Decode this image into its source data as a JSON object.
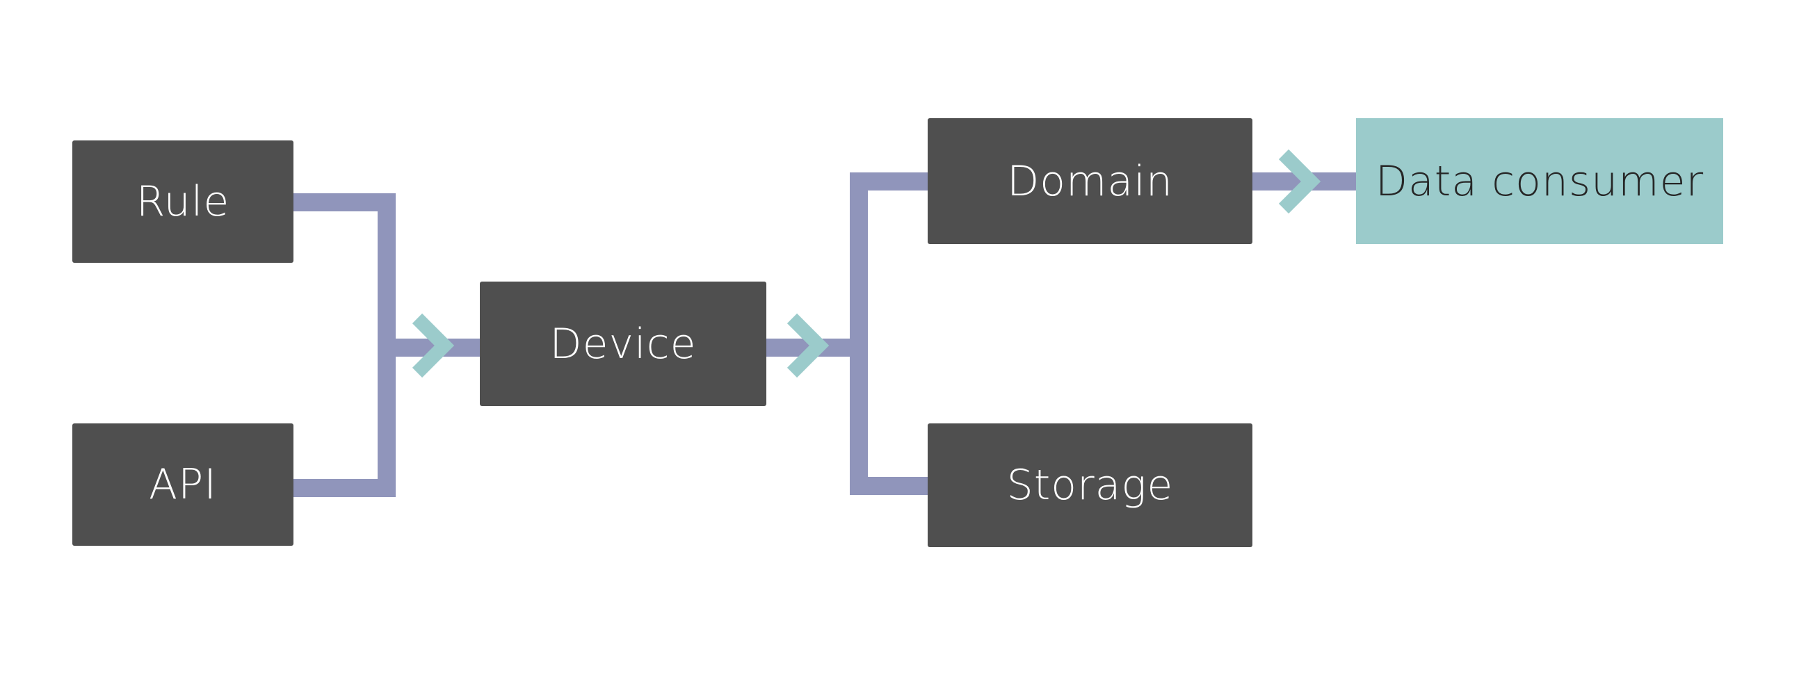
{
  "colors": {
    "box": "#4f4f4f",
    "box_text": "#ffffff",
    "connector": "#9095bb",
    "arrow": "#9bcbcb",
    "highlight_box": "#9bcbcb",
    "highlight_text": "#262626"
  },
  "nodes": {
    "rule": "Rule",
    "api": "API",
    "device": "Device",
    "domain": "Domain",
    "storage": "Storage",
    "data_consumer": "Data consumer"
  },
  "edges": [
    {
      "from": "rule",
      "to": "device"
    },
    {
      "from": "api",
      "to": "device"
    },
    {
      "from": "device",
      "to": "domain"
    },
    {
      "from": "device",
      "to": "storage"
    },
    {
      "from": "domain",
      "to": "data_consumer"
    }
  ]
}
